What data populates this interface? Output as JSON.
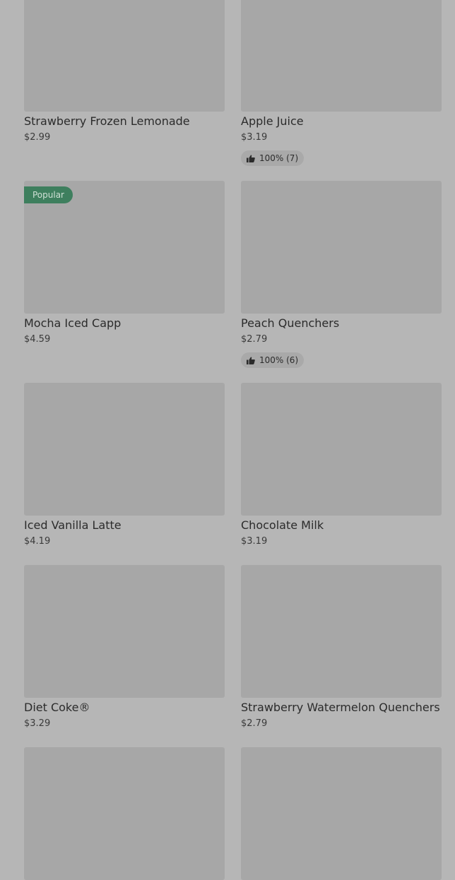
{
  "colors": {
    "page_bg": "#b6b6b6",
    "image_placeholder": "#a7a7a7",
    "popular_badge": "#3e7f5e",
    "rating_pill": "#a9a9a9"
  },
  "items": [
    {
      "name": "Strawberry Frozen Lemonade",
      "price": "$2.99",
      "badge": "",
      "rating": ""
    },
    {
      "name": "Apple Juice",
      "price": "$3.19",
      "badge": "",
      "rating": "100% (7)"
    },
    {
      "name": "Mocha Iced Capp",
      "price": "$4.59",
      "badge": "Popular",
      "rating": ""
    },
    {
      "name": "Peach Quenchers",
      "price": "$2.79",
      "badge": "",
      "rating": "100% (6)"
    },
    {
      "name": "Iced Vanilla Latte",
      "price": "$4.19",
      "badge": "",
      "rating": ""
    },
    {
      "name": "Chocolate Milk",
      "price": "$3.19",
      "badge": "",
      "rating": ""
    },
    {
      "name": "Diet Coke®",
      "price": "$3.29",
      "badge": "",
      "rating": ""
    },
    {
      "name": "Strawberry Watermelon Quenchers",
      "price": "$2.79",
      "badge": "",
      "rating": ""
    }
  ],
  "icons": {
    "rating": "thumbs-up-icon"
  }
}
